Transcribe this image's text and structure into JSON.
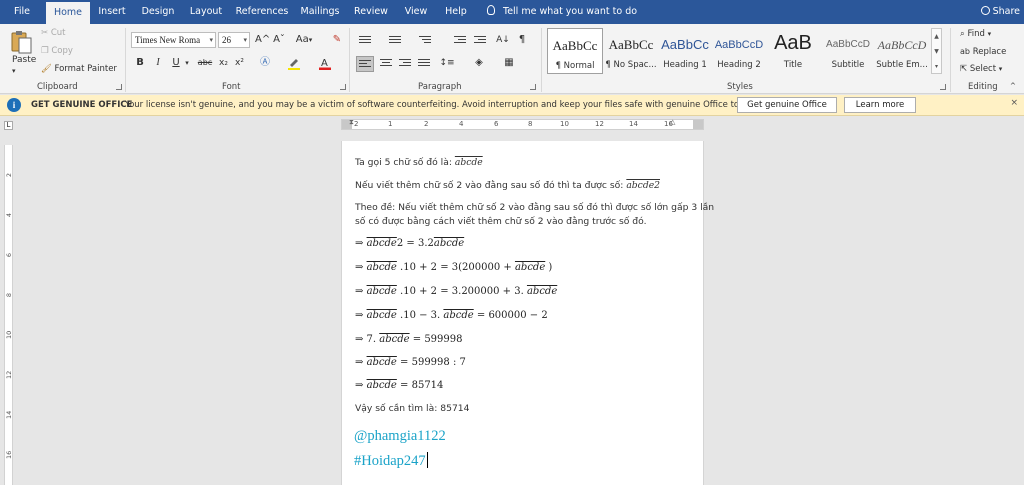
{
  "tabs": [
    "File",
    "Home",
    "Insert",
    "Design",
    "Layout",
    "References",
    "Mailings",
    "Review",
    "View",
    "Help"
  ],
  "tell_me": "Tell me what you want to do",
  "share": "Share",
  "clipboard": {
    "paste": "Paste",
    "cut": "Cut",
    "copy": "Copy",
    "format_painter": "Format Painter",
    "label": "Clipboard"
  },
  "font": {
    "name": "Times New Roma",
    "size": "26",
    "grow": "A^",
    "shrink": "Aˇ",
    "case": "Aa",
    "bold": "B",
    "italic": "I",
    "underline": "U",
    "strike": "abc",
    "sub": "x₂",
    "sup": "x²",
    "label": "Font"
  },
  "paragraph": {
    "label": "Paragraph",
    "pilcrow": "¶"
  },
  "styles": {
    "label": "Styles",
    "items": [
      {
        "preview": "AaBbCc",
        "name": "¶ Normal"
      },
      {
        "preview": "AaBbCc",
        "name": "¶ No Spac..."
      },
      {
        "preview": "AaBbCc",
        "name": "Heading 1"
      },
      {
        "preview": "AaBbCcD",
        "name": "Heading 2"
      },
      {
        "preview": "AaB",
        "name": "Title"
      },
      {
        "preview": "AaBbCcD",
        "name": "Subtitle"
      },
      {
        "preview": "AaBbCcD",
        "name": "Subtle Em..."
      }
    ]
  },
  "editing": {
    "find": "Find",
    "replace": "Replace",
    "select": "Select",
    "label": "Editing"
  },
  "notify": {
    "title": "GET GENUINE OFFICE",
    "message": "Your license isn't genuine, and you may be a victim of software counterfeiting. Avoid interruption and keep your files safe with genuine Office today.",
    "btn_genuine": "Get genuine Office",
    "btn_learn": "Learn more",
    "close": "×"
  },
  "ruler": {
    "numbers": [
      "2",
      "1",
      "2",
      "4",
      "6",
      "8",
      "10",
      "12",
      "14",
      "16"
    ],
    "vnumbers": [
      "2",
      "4",
      "6",
      "8",
      "10",
      "12",
      "14",
      "16"
    ],
    "tab_selector": "L"
  },
  "doc": {
    "p1": "Ta gọi 5 chữ số đó là: ",
    "p1_math": "abcde",
    "p2": "Nếu viết thêm chữ số 2 vào đằng sau số đó thì ta được số: ",
    "p2_math": "abcde2",
    "p3_a": "Theo đề: Nếu viết thêm chữ số 2 vào đằng sau số đó thì được số lớn gấp 3 lần",
    "p3_b": "số có được bằng cách viết thêm chữ số 2 vào đằng trước số đó.",
    "steps": [
      {
        "pre": "⇒ ",
        "ov": "abcde",
        "post": "2 = 3.2",
        "ov2": "abcde",
        "post2": ""
      },
      {
        "pre": "⇒ ",
        "ov": "abcde",
        "post": " .10 + 2 = 3(200000 + ",
        "ov2": "abcde",
        "post2": " )"
      },
      {
        "pre": "⇒ ",
        "ov": "abcde",
        "post": " .10 + 2 = 3.200000 + 3. ",
        "ov2": "abcde",
        "post2": ""
      },
      {
        "pre": "⇒ ",
        "ov": "abcde",
        "post": " .10 − 3. ",
        "ov2": "abcde",
        "post2": " = 600000 − 2"
      },
      {
        "pre": "⇒ 7. ",
        "ov": "abcde",
        "post": " = 599998",
        "ov2": "",
        "post2": ""
      },
      {
        "pre": "⇒ ",
        "ov": "abcde",
        "post": " = 599998 : 7",
        "ov2": "",
        "post2": ""
      },
      {
        "pre": "⇒ ",
        "ov": "abcde",
        "post": " = 85714",
        "ov2": "",
        "post2": ""
      }
    ],
    "conclusion": "Vậy số cần tìm là: 85714",
    "tag1": "@phamgia1122",
    "tag2": "#Hoidap247"
  }
}
